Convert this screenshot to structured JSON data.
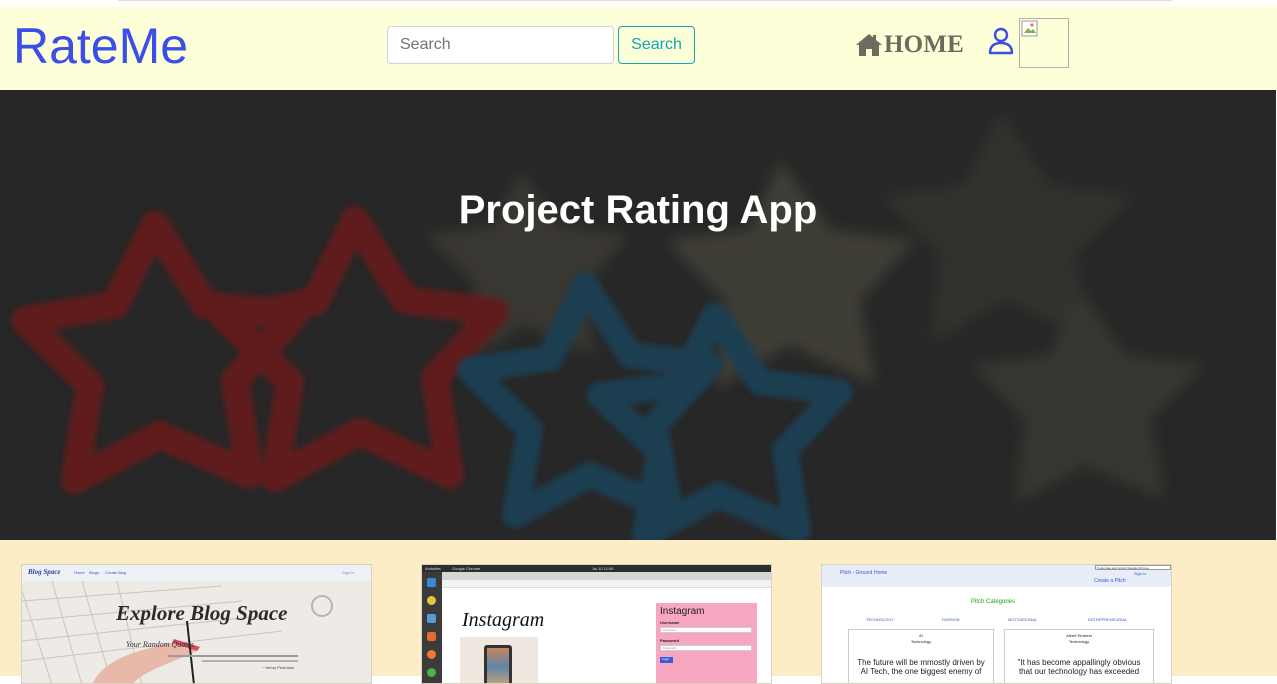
{
  "app": {
    "brand": "RateMe"
  },
  "navbar": {
    "search_placeholder": "Search",
    "search_button": "Search",
    "home_label": "HOME",
    "home_icon": "home-icon",
    "profile_icon": "user-icon",
    "avatar_icon": "broken-image"
  },
  "hero": {
    "title": "Project Rating App"
  },
  "projects": [
    {
      "nav_brand": "Blog Space",
      "nav_links": [
        "Home",
        "Blogs",
        "Create Blog"
      ],
      "nav_signin": "Sign In",
      "heading": "Explore Blog Space",
      "subheading": "Your Random Quotes",
      "author": "~ Henry Pedrosdo"
    },
    {
      "tabs": [
        "Activities",
        "Google Chrome"
      ],
      "clock": "Jul 10 11:59",
      "brand": "Instagram",
      "form_title": "Instagram",
      "username_label": "Username",
      "username_placeholder": "Username",
      "password_label": "Password",
      "password_placeholder": "Password",
      "login_button": "Login"
    },
    {
      "nav_brand": "Pitch - Ground",
      "nav_home": "Home",
      "nav_right": "Create a Pitch",
      "nav_signin": "Sign In",
      "tooltip": "Customise and control Google Chrome",
      "categories_title": "Pitch Categories",
      "categories": [
        "TECHNOLOGY",
        "FASHION",
        "MOTIVATIONAL",
        "ENTREPRENEURIAL"
      ],
      "pitch1_author": "AI",
      "pitch1_category": "Technology",
      "pitch1_text": "The future will be mmostly driven by AI Tech, the one biggest enemy of",
      "pitch2_author": "Albert Einstein",
      "pitch2_category": "Technology",
      "pitch2_text": "\"It has become appallingly obvious that our technology has exceeded"
    }
  ],
  "colors": {
    "navbar_bg": "#fdffd8",
    "brand": "#3c4ee8",
    "accent": "#17a2b8",
    "projects_bg": "#fdedc6",
    "hero_overlay": "#2c2c2c"
  }
}
